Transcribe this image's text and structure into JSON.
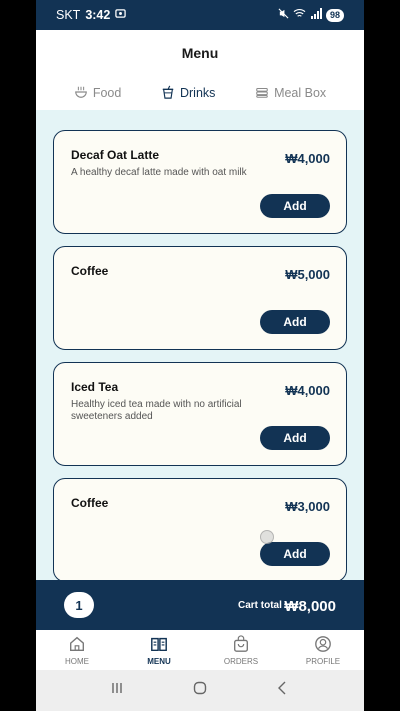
{
  "status_bar": {
    "carrier": "SKT",
    "time": "3:42",
    "battery": "98"
  },
  "header": {
    "title": "Menu"
  },
  "tabs": [
    {
      "label": "Food",
      "icon": "bowl-icon",
      "active": false
    },
    {
      "label": "Drinks",
      "icon": "cup-icon",
      "active": true
    },
    {
      "label": "Meal Box",
      "icon": "box-icon",
      "active": false
    }
  ],
  "items": [
    {
      "name": "Decaf Oat Latte",
      "description": "A healthy decaf latte made with oat milk",
      "price": "₩4,000",
      "add_label": "Add"
    },
    {
      "name": "Coffee",
      "description": "",
      "price": "₩5,000",
      "add_label": "Add"
    },
    {
      "name": "Iced Tea",
      "description": "Healthy iced tea made with no artificial sweeteners added",
      "price": "₩4,000",
      "add_label": "Add"
    },
    {
      "name": "Coffee",
      "description": "",
      "price": "₩3,000",
      "add_label": "Add"
    }
  ],
  "cart": {
    "count": "1",
    "label": "Cart total",
    "total": "₩8,000"
  },
  "bottom_nav": [
    {
      "label": "HOME",
      "icon": "home-icon",
      "active": false
    },
    {
      "label": "MENU",
      "icon": "book-icon",
      "active": true
    },
    {
      "label": "ORDERS",
      "icon": "bag-icon",
      "active": false
    },
    {
      "label": "PROFILE",
      "icon": "user-icon",
      "active": false
    }
  ],
  "colors": {
    "primary": "#123354",
    "list_bg": "#e4f4f6",
    "card_bg": "#fdfcf5"
  }
}
